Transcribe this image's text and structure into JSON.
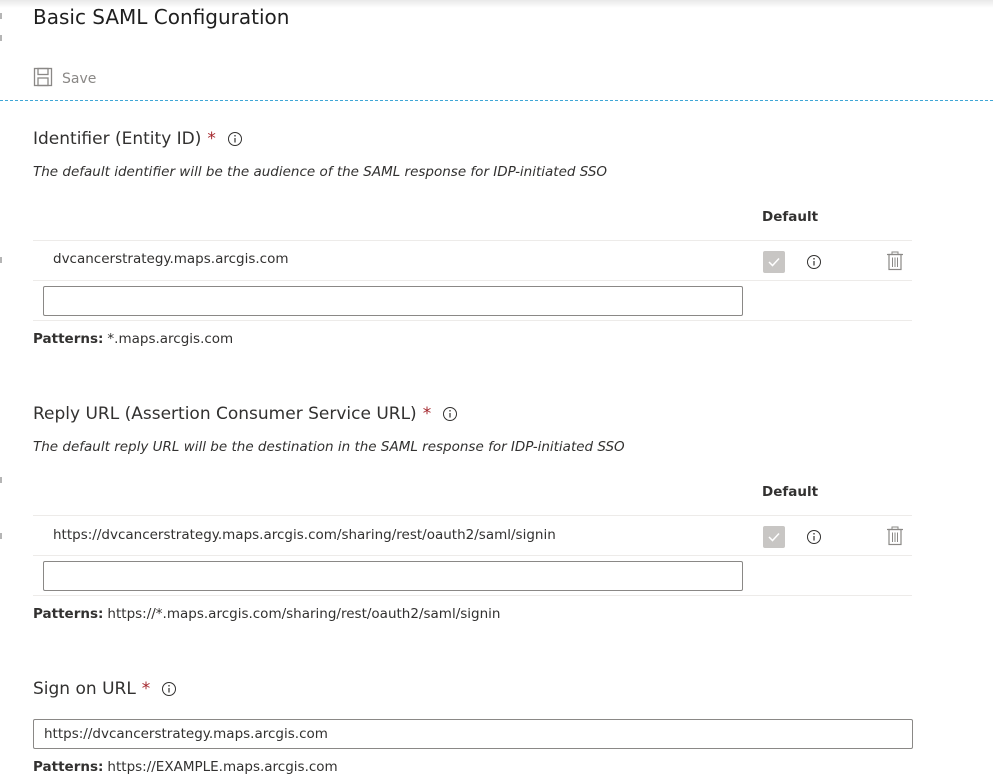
{
  "page": {
    "title": "Basic SAML Configuration"
  },
  "toolbar": {
    "save_label": "Save"
  },
  "identifier": {
    "title": "Identifier (Entity ID)",
    "required_mark": "*",
    "description": "The default identifier will be the audience of the SAML response for IDP-initiated SSO",
    "default_header": "Default",
    "rows": [
      {
        "value": "dvcancerstrategy.maps.arcgis.com",
        "is_default": true
      }
    ],
    "new_value": "",
    "patterns_label": "Patterns:",
    "patterns_value": "*.maps.arcgis.com"
  },
  "reply_url": {
    "title": "Reply URL (Assertion Consumer Service URL)",
    "required_mark": "*",
    "description": "The default reply URL will be the destination in the SAML response for IDP-initiated SSO",
    "default_header": "Default",
    "rows": [
      {
        "value": "https://dvcancerstrategy.maps.arcgis.com/sharing/rest/oauth2/saml/signin",
        "is_default": true
      }
    ],
    "new_value": "",
    "patterns_label": "Patterns:",
    "patterns_value": "https://*.maps.arcgis.com/sharing/rest/oauth2/saml/signin"
  },
  "sign_on": {
    "title": "Sign on URL",
    "required_mark": "*",
    "value": "https://dvcancerstrategy.maps.arcgis.com",
    "patterns_label": "Patterns:",
    "patterns_value": "https://EXAMPLE.maps.arcgis.com"
  },
  "icons": {
    "save": "save-icon",
    "info": "info-icon",
    "check": "checkmark-icon",
    "delete": "trash-icon"
  },
  "colors": {
    "required": "#a4262c",
    "divider_accent": "#3fa7d6",
    "disabled_checkbox": "#c8c6c4"
  }
}
